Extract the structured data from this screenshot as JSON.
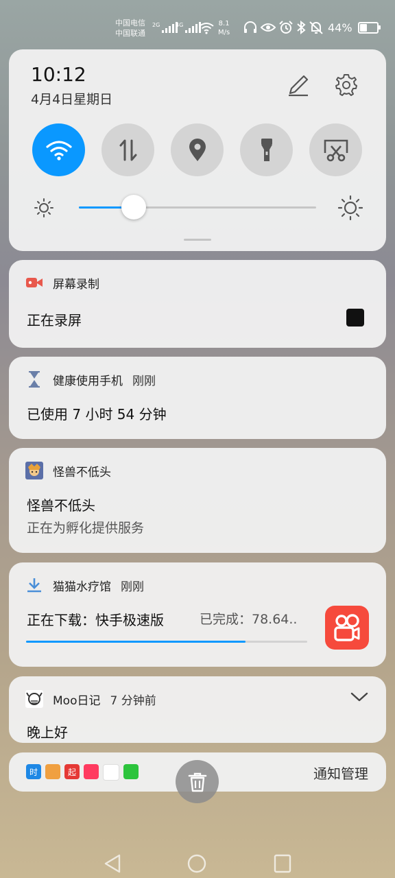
{
  "status_bar": {
    "carrier_1": "中国电信",
    "carrier_2": "中国联通",
    "signal_1_tag": "2G",
    "signal_2_tag": "4G",
    "net_speed_value": "8.1",
    "net_speed_unit": "M/s",
    "battery_percent": "44%",
    "battery_level": 0.44,
    "icons": [
      "signal-icon",
      "signal-icon",
      "wifi-icon",
      "headphones-icon",
      "eye-icon",
      "alarm-icon",
      "bluetooth-icon",
      "mute-bell-icon",
      "battery-icon"
    ]
  },
  "quick_settings": {
    "time": "10:12",
    "date": "4月4日星期日",
    "tiles": [
      {
        "name": "wifi",
        "icon": "wifi-icon",
        "on": true
      },
      {
        "name": "mobile-data",
        "icon": "data-arrows-icon",
        "on": false
      },
      {
        "name": "location",
        "icon": "location-pin-icon",
        "on": false
      },
      {
        "name": "flashlight",
        "icon": "flashlight-icon",
        "on": false
      },
      {
        "name": "screenshot",
        "icon": "scissors-screen-icon",
        "on": false
      }
    ],
    "brightness_level": 0.23,
    "accent_color": "#0a98ff"
  },
  "notifications": {
    "screen_record": {
      "app": "屏幕录制",
      "title": "正在录屏",
      "icon": "video-camera-icon",
      "icon_color": "#e8584c"
    },
    "health": {
      "app": "健康使用手机",
      "when": "刚刚",
      "title": "已使用 7 小时 54 分钟",
      "icon": "hourglass-icon"
    },
    "monster": {
      "app": "怪兽不低头",
      "title": "怪兽不低头",
      "subtitle": "正在为孵化提供服务",
      "icon": "game-avatar-icon"
    },
    "download": {
      "app": "猫猫水疗馆",
      "when": "刚刚",
      "title": "正在下载：快手极速版",
      "done_label": "已完成：78.64..",
      "progress": 0.78,
      "icon": "download-icon",
      "app_icon": "kuaishou-icon",
      "app_icon_color": "#f64a3c"
    },
    "moo": {
      "app": "Moo日记",
      "when": "7 分钟前",
      "title": "晚上好",
      "icon": "moo-avatar-icon"
    }
  },
  "bottom_bar": {
    "manage_label": "通知管理",
    "mini_apps": [
      {
        "icon": "shi-app-icon",
        "color": "#1e88e5",
        "glyph": "时"
      },
      {
        "icon": "monkey-app-icon",
        "color": "#f0a040",
        "glyph": ""
      },
      {
        "icon": "qi-app-icon",
        "color": "#e53935",
        "glyph": "起"
      },
      {
        "icon": "music-app-icon",
        "color": "#ff3b60",
        "glyph": ""
      },
      {
        "icon": "people-daily-icon",
        "color": "#ffffff",
        "glyph": ""
      },
      {
        "icon": "iqiyi-icon",
        "color": "#2cc43c",
        "glyph": ""
      }
    ]
  },
  "nav_bar": {
    "buttons": [
      "back-icon",
      "home-icon",
      "recents-icon"
    ]
  }
}
